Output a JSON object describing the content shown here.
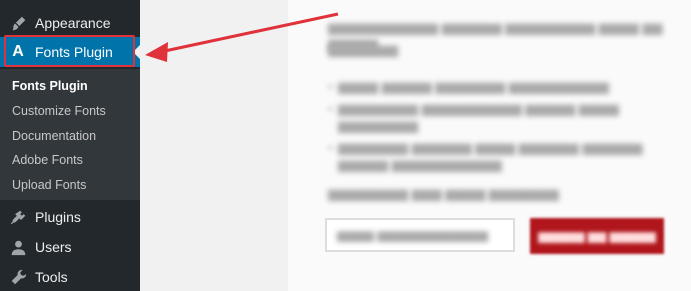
{
  "sidebar": {
    "items": {
      "appearance": {
        "label": "Appearance",
        "icon": "paintbrush-icon"
      },
      "fonts": {
        "label": "Fonts Plugin",
        "icon": "letter-a-icon",
        "icon_glyph": "A"
      },
      "plugins": {
        "label": "Plugins",
        "icon": "plug-icon"
      },
      "users": {
        "label": "Users",
        "icon": "user-icon"
      },
      "tools": {
        "label": "Tools",
        "icon": "wrench-icon"
      }
    },
    "submenu": [
      {
        "label": "Fonts Plugin",
        "current": true
      },
      {
        "label": "Customize Fonts",
        "current": false
      },
      {
        "label": "Documentation",
        "current": false
      },
      {
        "label": "Adobe Fonts",
        "current": false
      },
      {
        "label": "Upload Fonts",
        "current": false
      }
    ]
  },
  "colors": {
    "sidebar_bg": "#23282d",
    "submenu_bg": "#32373c",
    "active_bg": "#0073aa",
    "highlight_annotation": "#e0323a",
    "send_button": "#b0161c"
  }
}
